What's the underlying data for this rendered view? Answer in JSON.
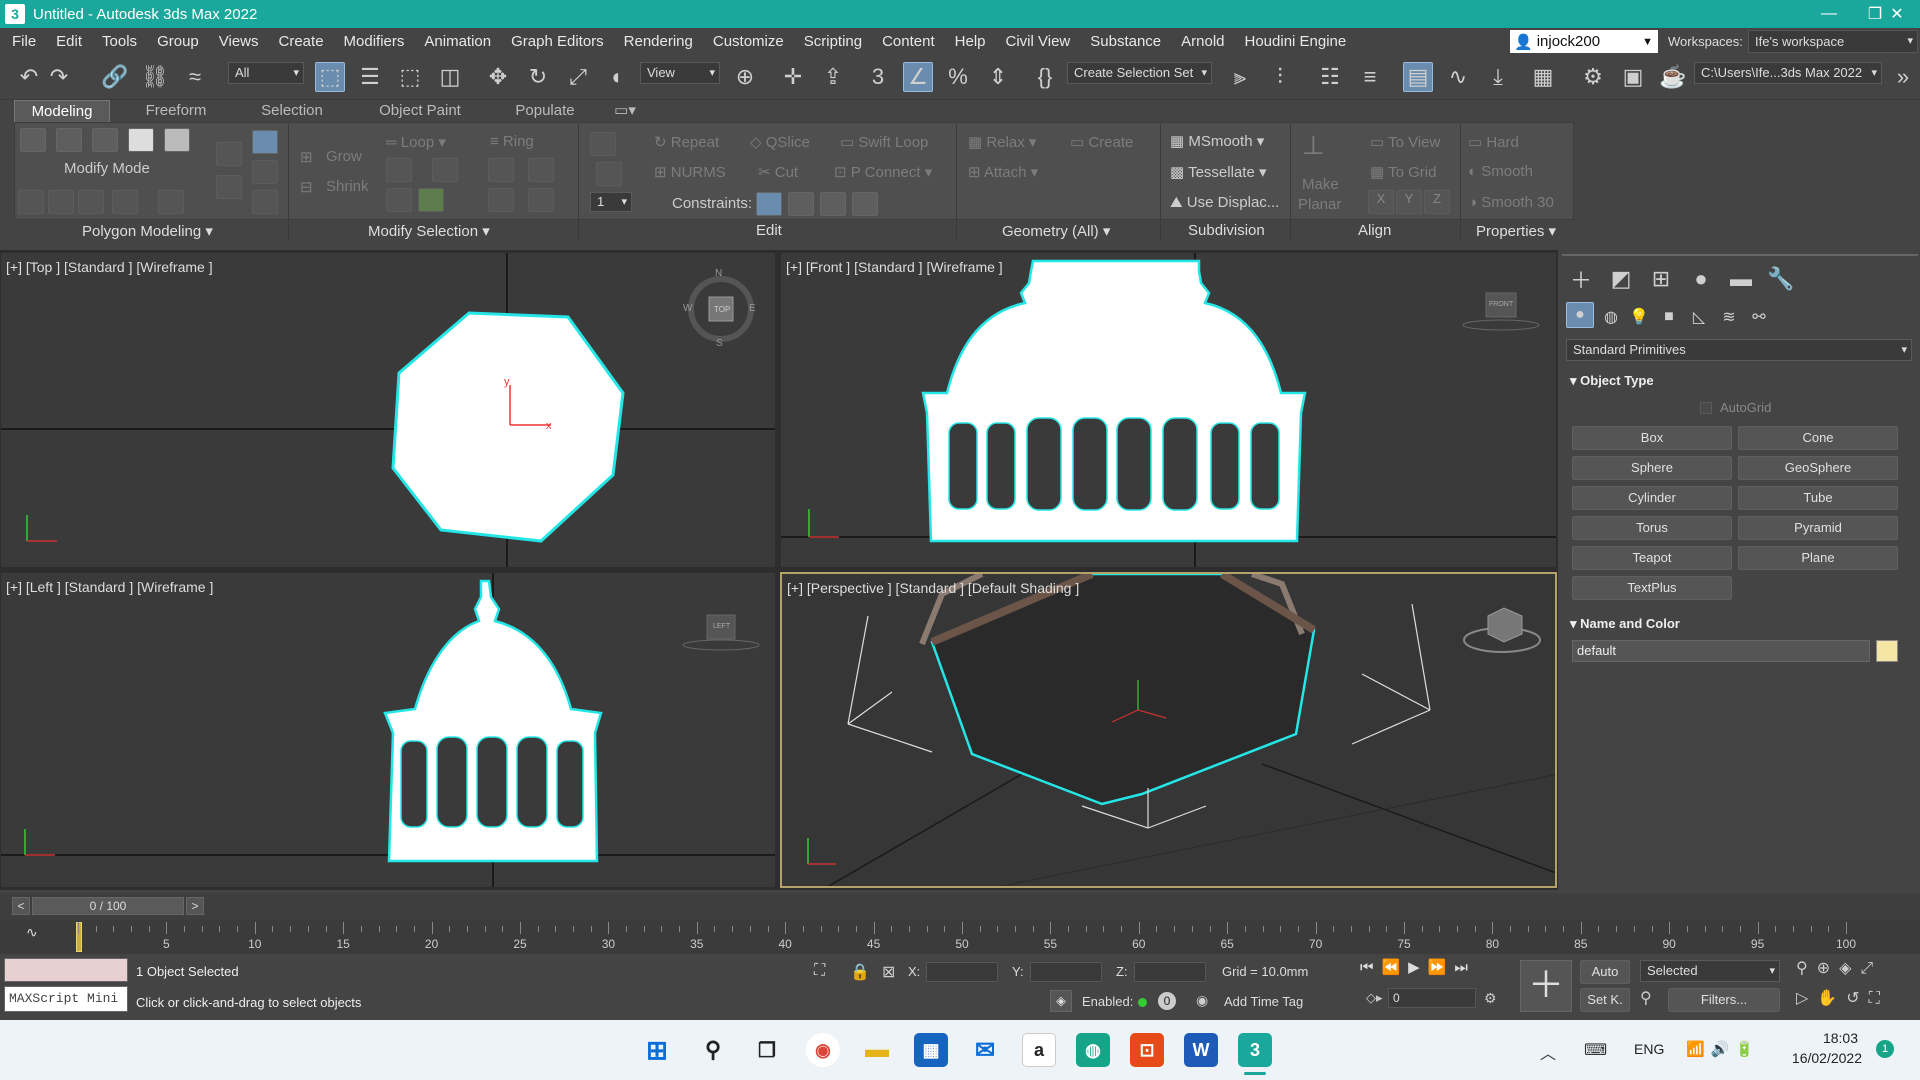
{
  "window": {
    "title": "Untitled - Autodesk 3ds Max 2022",
    "app_logo": "3",
    "minimize": "—",
    "maximize": "❐",
    "close": "✕"
  },
  "menu": [
    "File",
    "Edit",
    "Tools",
    "Group",
    "Views",
    "Create",
    "Modifiers",
    "Animation",
    "Graph Editors",
    "Rendering",
    "Customize",
    "Scripting",
    "Content",
    "Help",
    "Civil View",
    "Substance",
    "Arnold",
    "Houdini Engine"
  ],
  "user": {
    "name": "injock200"
  },
  "workspace": {
    "label": "Workspaces:",
    "value": "Ife's workspace"
  },
  "toolbar": {
    "filter": "All",
    "ref_coord": "View",
    "selection_set": "Create Selection Set",
    "project_path": "C:\\Users\\Ife...3ds Max 2022"
  },
  "ribbon": {
    "tabs": [
      "Modeling",
      "Freeform",
      "Selection",
      "Object Paint",
      "Populate"
    ],
    "active_tab": "Modeling",
    "mode": "Modify Mode",
    "groups": {
      "polygon_modeling": "Polygon Modeling",
      "modify_selection": "Modify Selection",
      "edit": "Edit",
      "geometry": "Geometry (All)",
      "subdivision": "Subdivision",
      "align": "Align",
      "properties": "Properties"
    },
    "items": {
      "grow": "Grow",
      "shrink": "Shrink",
      "loop": "Loop",
      "ring": "Ring",
      "repeat": "Repeat",
      "qslice": "QSlice",
      "swift_loop": "Swift Loop",
      "nurms": "NURMS",
      "cut": "Cut",
      "p_connect": "P Connect",
      "constraints": "Constraints:",
      "spinner_value": "1",
      "relax": "Relax",
      "create": "Create",
      "attach": "Attach",
      "msmooth": "MSmooth",
      "tessellate": "Tessellate",
      "use_displac": "Use Displac...",
      "make_planar_1": "Make",
      "make_planar_2": "Planar",
      "to_view": "To View",
      "to_grid": "To Grid",
      "x": "X",
      "y": "Y",
      "z": "Z",
      "hard": "Hard",
      "smooth": "Smooth",
      "smooth30": "Smooth 30"
    }
  },
  "viewports": {
    "top": {
      "label": "[+] [Top ] [Standard ] [Wireframe ]",
      "cube": "TOP",
      "n": "N",
      "s": "S",
      "e": "E",
      "w": "W"
    },
    "front": {
      "label": "[+] [Front ] [Standard ] [Wireframe ]",
      "cube": "FRONT"
    },
    "left": {
      "label": "[+] [Left ] [Standard ] [Wireframe ]",
      "cube": "LEFT"
    },
    "perspective": {
      "label": "[+] [Perspective ] [Standard ] [Default Shading ]"
    }
  },
  "command_panel": {
    "category": "Standard Primitives",
    "object_type_title": "Object Type",
    "autogrid": "AutoGrid",
    "buttons": [
      "Box",
      "Cone",
      "Sphere",
      "GeoSphere",
      "Cylinder",
      "Tube",
      "Torus",
      "Pyramid",
      "Teapot",
      "Plane",
      "TextPlus"
    ],
    "name_color_title": "Name and Color",
    "name_value": "default",
    "swatch_color": "#f5e6a6"
  },
  "timeline": {
    "frame": "0 / 100",
    "ticks": [
      "5",
      "10",
      "15",
      "20",
      "25",
      "30",
      "35",
      "40",
      "45",
      "50",
      "55",
      "60",
      "65",
      "70",
      "75",
      "80",
      "85",
      "90",
      "95",
      "100"
    ]
  },
  "status": {
    "maxscript": "MAXScript Mini",
    "selected": "1 Object Selected",
    "prompt": "Click or click-and-drag to select objects",
    "x_label": "X:",
    "y_label": "Y:",
    "z_label": "Z:",
    "grid": "Grid = 10.0mm",
    "enabled": "Enabled:",
    "add_time_tag": "Add Time Tag",
    "auto": "Auto",
    "set_key": "Set K.",
    "key_filter": "Selected",
    "filters": "Filters...",
    "frame_field": "0"
  },
  "taskbar": {
    "lang": "ENG",
    "time": "18:03",
    "date": "16/02/2022",
    "badge": "1"
  }
}
